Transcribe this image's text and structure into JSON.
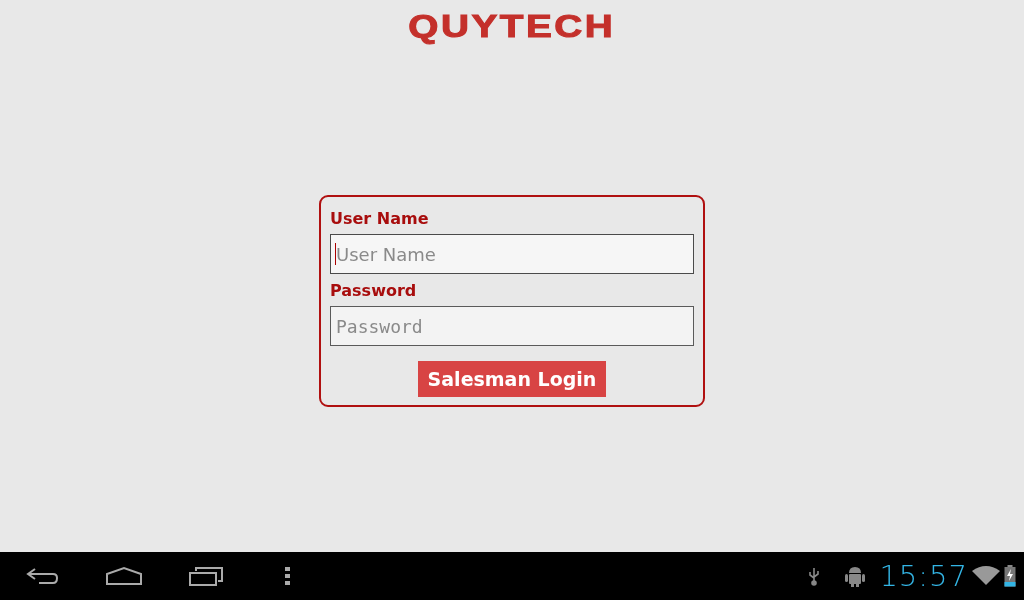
{
  "logo": "QUYTECH",
  "form": {
    "fields": [
      {
        "label": "User Name",
        "placeholder": "User Name",
        "kind": "text",
        "focused": true
      },
      {
        "label": "Password",
        "placeholder": "Password",
        "kind": "password",
        "focused": false
      }
    ],
    "submit": "Salesman Login"
  },
  "nav_bar": {
    "clock": "15:57"
  }
}
